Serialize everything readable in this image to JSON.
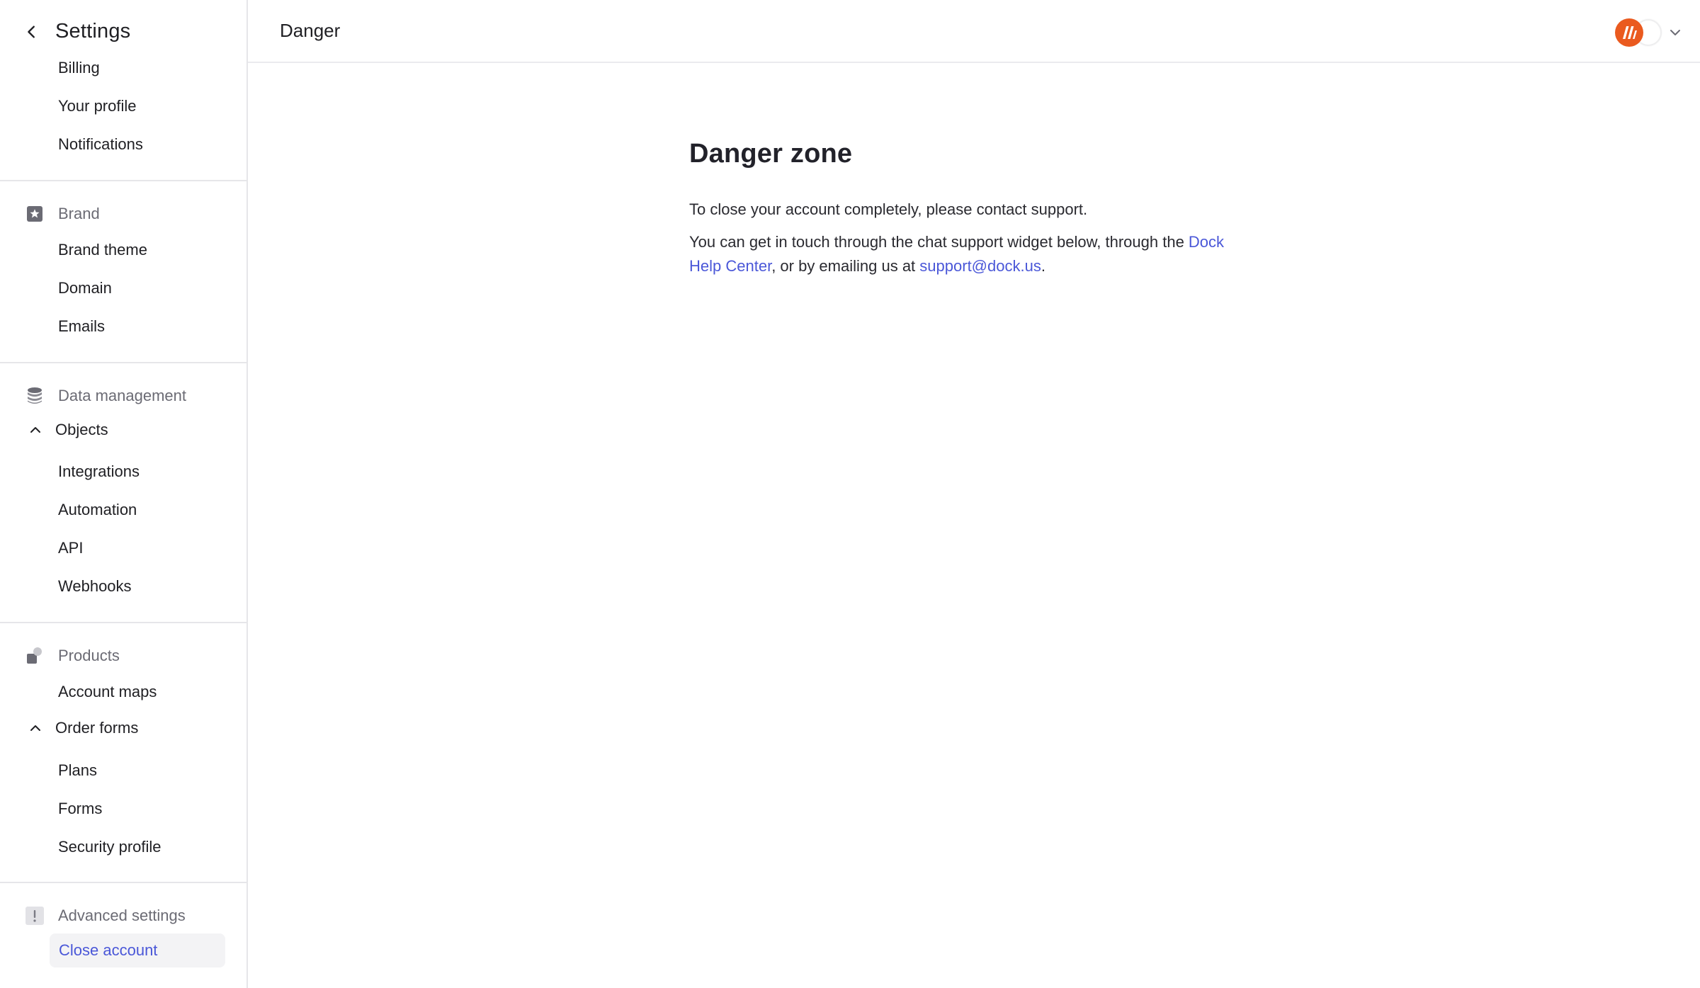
{
  "sidebar": {
    "title": "Settings",
    "top_items": [
      "Billing",
      "Your profile",
      "Notifications"
    ],
    "brand": {
      "header": "Brand",
      "items": [
        "Brand theme",
        "Domain",
        "Emails"
      ]
    },
    "data_management": {
      "header": "Data management",
      "objects_label": "Objects",
      "items": [
        "Integrations",
        "Automation",
        "API",
        "Webhooks"
      ]
    },
    "products": {
      "header": "Products",
      "account_maps": "Account maps",
      "order_forms_label": "Order forms",
      "items": [
        "Plans",
        "Forms",
        "Security profile"
      ]
    },
    "advanced": {
      "header": "Advanced settings",
      "active_item": "Close account"
    }
  },
  "topbar": {
    "crumb": "Danger"
  },
  "main": {
    "title": "Danger zone",
    "line1": "To close your account completely, please contact support.",
    "line2_pre": "You can get in touch through the chat support widget below, through the ",
    "help_link": "Dock Help Center",
    "line2_mid": ", or by emailing us at ",
    "email_link": "support@dock.us",
    "line2_post": "."
  },
  "colors": {
    "accent": "#4a57d8",
    "brand_logo": "#ea5a1f",
    "active_bg": "#f3f3f5"
  },
  "icons": {
    "back": "chevron-left-icon",
    "brand": "star-badge-icon",
    "data_management": "database-icon",
    "products": "product-icon",
    "advanced": "exclamation-icon",
    "expand": "chevron-up-icon",
    "account_menu": "chevron-down-icon"
  }
}
